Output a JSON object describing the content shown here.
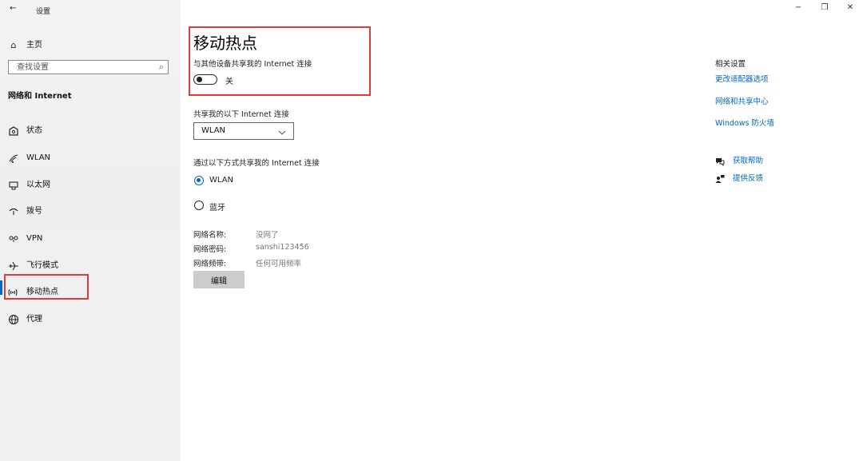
{
  "window": {
    "title": "设置",
    "back_icon": "←",
    "controls": {
      "minimize": "−",
      "restore": "❐",
      "close": "✕"
    }
  },
  "sidebar": {
    "home": {
      "icon": "⌂",
      "label": "主页"
    },
    "search": {
      "placeholder": "查找设置",
      "icon": "⌕"
    },
    "section_title": "网络和 Internet",
    "items": [
      {
        "icon": "⌂",
        "label": "状态"
      },
      {
        "icon": "◜",
        "label": "WLAN"
      },
      {
        "icon": "▭",
        "label": "以太网"
      },
      {
        "icon": "☎",
        "label": "拨号"
      },
      {
        "icon": "∞",
        "label": "VPN"
      },
      {
        "icon": "✈",
        "label": "飞行模式"
      },
      {
        "icon": "((·))",
        "label": "移动热点"
      },
      {
        "icon": "⊕",
        "label": "代理"
      }
    ],
    "selected_index": 6
  },
  "main": {
    "title": "移动热点",
    "share_label": "与其他设备共享我的 Internet 连接",
    "toggle_state": "关",
    "share_from_label": "共享我的以下 Internet 连接",
    "share_from_value": "WLAN",
    "share_via_label": "通过以下方式共享我的 Internet 连接",
    "share_via_options": [
      "WLAN",
      "蓝牙"
    ],
    "share_via_selected": 0,
    "network_info": [
      {
        "label": "网络名称:",
        "value": "没网了"
      },
      {
        "label": "网络密码:",
        "value": "sanshi123456"
      },
      {
        "label": "网络频带:",
        "value": "任何可用频率"
      }
    ],
    "edit_button": "编辑"
  },
  "related": {
    "title": "相关设置",
    "links": [
      "更改适配器选项",
      "网络和共享中心",
      "Windows 防火墙"
    ],
    "help": [
      {
        "icon": "help-icon",
        "label": "获取帮助"
      },
      {
        "icon": "feedback-icon",
        "label": "提供反馈"
      }
    ]
  },
  "colors": {
    "accent": "#0067c0",
    "highlight_box": "#e03b3b"
  }
}
